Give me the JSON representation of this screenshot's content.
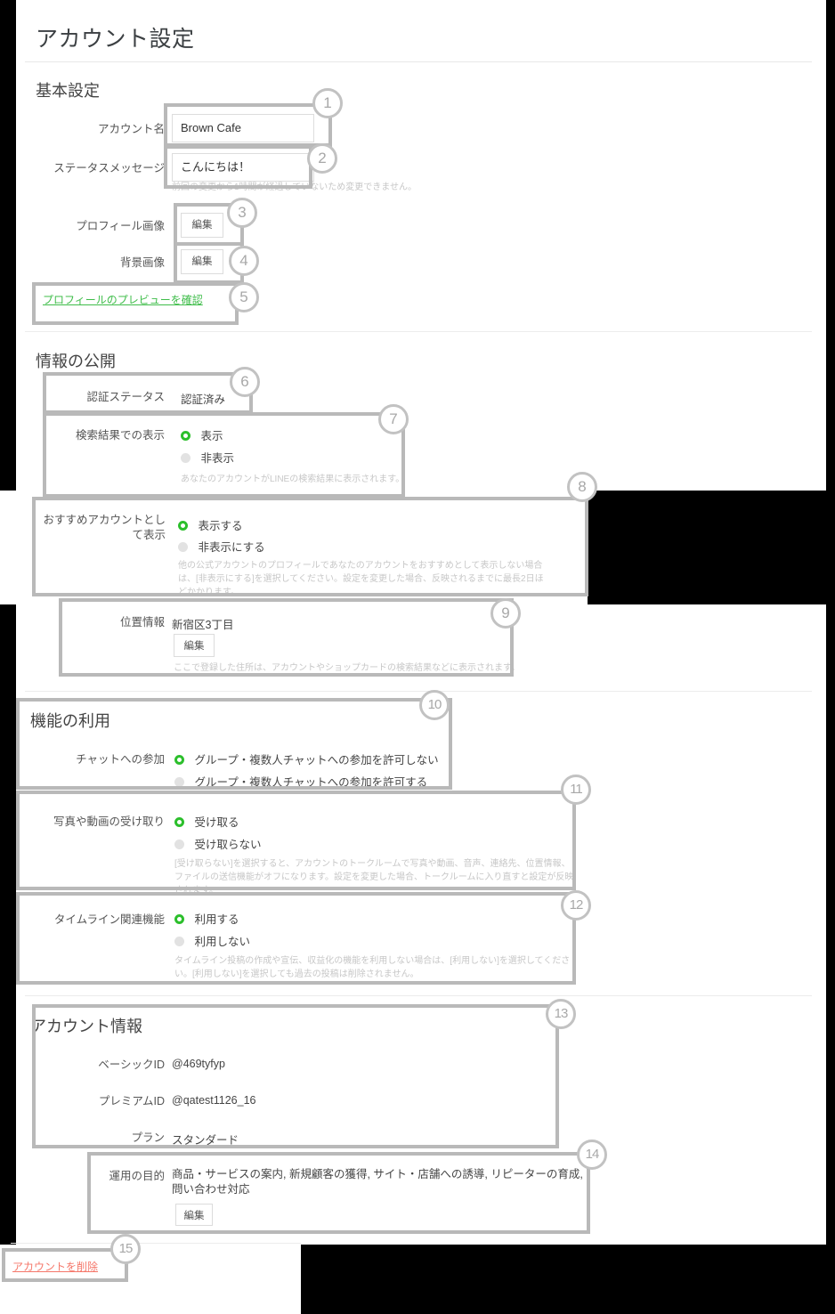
{
  "page": {
    "title": "アカウント設定"
  },
  "sections": {
    "basic": {
      "heading": "基本設定",
      "account_name": {
        "label": "アカウント名",
        "value": "Brown Cafe"
      },
      "status_message": {
        "label": "ステータスメッセージ",
        "value": "こんにちは！",
        "note": "前回の変更から1時間が経過していないため変更できません。"
      },
      "profile_image": {
        "label": "プロフィール画像",
        "edit_label": "編集"
      },
      "background_image": {
        "label": "背景画像",
        "edit_label": "編集"
      },
      "preview_link": "プロフィールのプレビューを確認"
    },
    "disclosure": {
      "heading": "情報の公開",
      "verification": {
        "label": "認証ステータス",
        "value": "認証済み"
      },
      "search_display": {
        "label": "検索結果での表示",
        "options": [
          "表示",
          "非表示"
        ],
        "selected": "表示",
        "note": "あなたのアカウントがLINEの検索結果に表示されます。"
      },
      "recommended": {
        "label": "おすすめアカウントとして表示",
        "options": [
          "表示する",
          "非表示にする"
        ],
        "selected": "表示する",
        "note": "他の公式アカウントのプロフィールであなたのアカウントをおすすめとして表示しない場合は、[非表示にする]を選択してください。設定を変更した場合、反映されるまでに最長2日ほどかかります。"
      },
      "location": {
        "label": "位置情報",
        "value": "新宿区3丁目",
        "edit_label": "編集",
        "note": "ここで登録した住所は、アカウントやショップカードの検索結果などに表示されます。"
      }
    },
    "features": {
      "heading": "機能の利用",
      "chat_join": {
        "label": "チャットへの参加",
        "options": [
          "グループ・複数人チャットへの参加を許可しない",
          "グループ・複数人チャットへの参加を許可する"
        ],
        "selected": "グループ・複数人チャットへの参加を許可しない"
      },
      "media_receive": {
        "label": "写真や動画の受け取り",
        "options": [
          "受け取る",
          "受け取らない"
        ],
        "selected": "受け取る",
        "note": "[受け取らない]を選択すると、アカウントのトークルームで写真や動画、音声、連絡先、位置情報、ファイルの送信機能がオフになります。設定を変更した場合、トークルームに入り直すと設定が反映されます。"
      },
      "timeline": {
        "label": "タイムライン関連機能",
        "options": [
          "利用する",
          "利用しない"
        ],
        "selected": "利用する",
        "note": "タイムライン投稿の作成や宣伝、収益化の機能を利用しない場合は、[利用しない]を選択してください。[利用しない]を選択しても過去の投稿は削除されません。"
      }
    },
    "account_info": {
      "heading": "アカウント情報",
      "basic_id": {
        "label": "ベーシックID",
        "value": "@469tyfyp"
      },
      "premium_id": {
        "label": "プレミアムID",
        "value": "@qatest1126_16"
      },
      "plan": {
        "label": "プラン",
        "value": "スタンダード"
      },
      "purpose": {
        "label": "運用の目的",
        "value": "商品・サービスの案内, 新規顧客の獲得, サイト・店舗への誘導, リピーターの育成, 問い合わせ対応",
        "edit_label": "編集"
      }
    },
    "danger": {
      "delete_link": "アカウントを削除"
    }
  },
  "annotations": {
    "numbers": [
      "1",
      "2",
      "3",
      "4",
      "5",
      "6",
      "7",
      "8",
      "9",
      "10",
      "11",
      "12",
      "13",
      "14",
      "15"
    ]
  },
  "colors": {
    "accent_green": "#2cbf2c",
    "link_green": "#3fbd4a",
    "danger_red": "#f5776a",
    "annotation_grey": "#b9b9b9"
  }
}
